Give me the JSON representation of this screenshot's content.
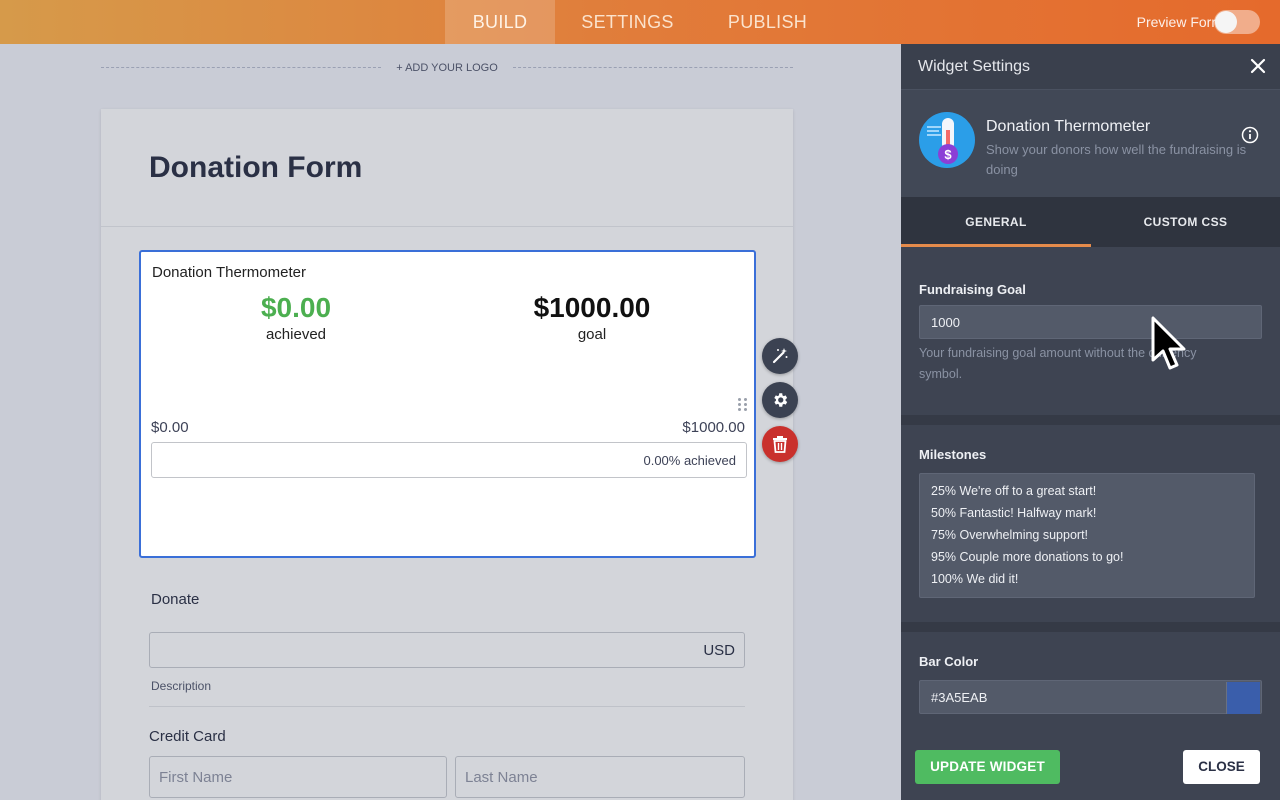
{
  "topbar": {
    "tabs": [
      {
        "label": "BUILD",
        "active": true
      },
      {
        "label": "SETTINGS",
        "active": false
      },
      {
        "label": "PUBLISH",
        "active": false
      }
    ],
    "preview_label": "Preview Form",
    "preview_enabled": false
  },
  "canvas": {
    "add_logo": "+ ADD YOUR LOGO",
    "form_title": "Donation Form",
    "thermometer": {
      "title": "Donation Thermometer",
      "achieved_amount": "$0.00",
      "achieved_label": "achieved",
      "goal_amount": "$1000.00",
      "goal_label": "goal",
      "range_min": "$0.00",
      "range_max": "$1000.00",
      "progress_text": "0.00% achieved",
      "progress_fraction": 0.0
    },
    "donate": {
      "label": "Donate",
      "currency": "USD",
      "description": "Description"
    },
    "credit_card": {
      "label": "Credit Card",
      "first_name_placeholder": "First Name",
      "last_name_placeholder": "Last Name"
    },
    "side_tools": [
      "magic-wand-icon",
      "gear-icon",
      "trash-icon"
    ]
  },
  "panel": {
    "title": "Widget Settings",
    "widget": {
      "name": "Donation Thermometer",
      "description": "Show your donors how well the fundraising is doing"
    },
    "tabs": [
      {
        "label": "GENERAL",
        "active": true
      },
      {
        "label": "CUSTOM CSS",
        "active": false
      }
    ],
    "goal": {
      "label": "Fundraising Goal",
      "value": "1000",
      "hint": "Your fundraising goal amount without the currency symbol."
    },
    "milestones": {
      "label": "Milestones",
      "lines": [
        "25% We're off to a great start!",
        "50% Fantastic! Halfway mark!",
        "75% Overwhelming support!",
        "95% Couple more donations to go!",
        "100% We did it!"
      ]
    },
    "bar_color": {
      "label": "Bar Color",
      "value": "#3A5EAB"
    },
    "update_button": "UPDATE WIDGET",
    "close_button": "CLOSE"
  },
  "colors": {
    "accent_orange": "#e56a2c",
    "achieved_green": "#4caf50",
    "selection_blue": "#3a6fd8",
    "update_green": "#4fbb61",
    "delete_red": "#c9302c"
  }
}
